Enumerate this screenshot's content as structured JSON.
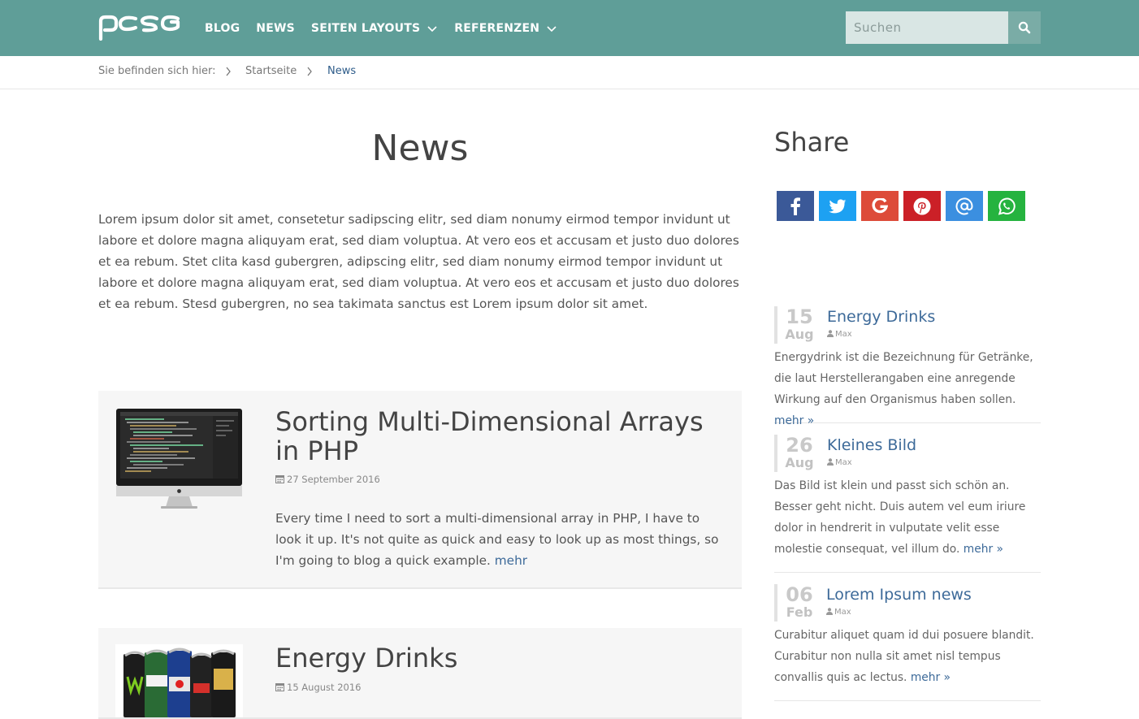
{
  "nav": {
    "items": [
      {
        "label": "BLOG"
      },
      {
        "label": "NEWS"
      },
      {
        "label": "SEITEN LAYOUTS"
      },
      {
        "label": "REFERENZEN"
      }
    ],
    "search_placeholder": "Suchen"
  },
  "breadcrumb": {
    "prefix": "Sie befinden sich hier:",
    "home": "Startseite",
    "current": "News"
  },
  "main": {
    "title": "News",
    "intro": "Lorem ipsum dolor sit amet, consetetur sadipscing elitr, sed diam nonumy eirmod tempor invidunt ut labore et dolore magna aliquyam erat, sed diam voluptua. At vero eos et accusam et justo duo dolores et ea rebum. Stet clita kasd gubergren, adipscing elitr, sed diam nonumy eirmod tempor invidunt ut labore et dolore magna aliquyam erat, sed diam voluptua. At vero eos et accusam et justo duo dolores et ea rebum. Stesd gubergren, no sea takimata sanctus est Lorem ipsum dolor sit amet.",
    "posts": [
      {
        "title": "Sorting Multi-Dimensional Arrays in PHP",
        "date": "27 September 2016",
        "excerpt": "Every time I need to sort a multi-dimensional array in PHP, I have to look it up. It's not quite as quick and easy to look up as most things, so I'm going to blog a quick example.",
        "more": "mehr"
      },
      {
        "title": "Energy Drinks",
        "date": "15 August 2016"
      }
    ]
  },
  "sidebar": {
    "share_title": "Share",
    "share_buttons": [
      {
        "icon": "facebook-icon",
        "color": "#3b5998"
      },
      {
        "icon": "twitter-icon",
        "color": "#1da1f2"
      },
      {
        "icon": "google-icon",
        "color": "#dd4b39"
      },
      {
        "icon": "pinterest-icon",
        "color": "#cb2027"
      },
      {
        "icon": "email-icon",
        "color": "#3b8fe0"
      },
      {
        "icon": "whatsapp-icon",
        "color": "#25b33f"
      }
    ],
    "news": [
      {
        "day": "15",
        "month": "Aug",
        "title": "Energy Drinks",
        "author": "Max",
        "text": "Energydrink ist die Bezeichnung für Getränke, die laut Herstellerangaben eine anregende Wirkung auf den Organismus haben sollen.",
        "more": "mehr »"
      },
      {
        "day": "26",
        "month": "Aug",
        "title": "Kleines Bild",
        "author": "Max",
        "text": "Das Bild ist klein und passt sich schön an. Besser geht nicht. Duis autem vel eum iriure dolor in hendrerit in vulputate velit esse molestie consequat, vel illum do.",
        "more": "mehr »"
      },
      {
        "day": "06",
        "month": "Feb",
        "title": "Lorem Ipsum news",
        "author": "Max",
        "text": "Curabitur aliquet quam id dui posuere blandit. Curabitur non nulla sit amet nisl tempus convallis quis ac lectus.",
        "more": "mehr »"
      }
    ]
  },
  "colors": {
    "header": "#5f9e98",
    "link": "#3d6a99"
  }
}
